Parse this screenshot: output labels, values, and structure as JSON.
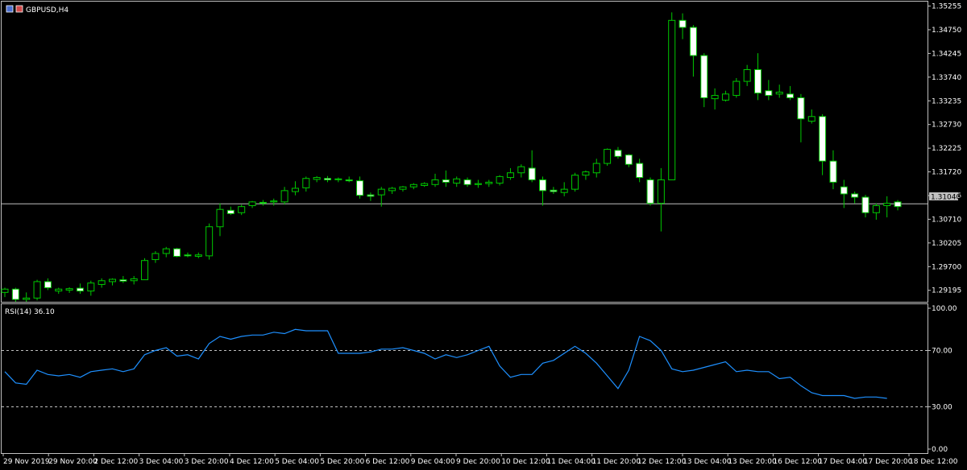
{
  "header": {
    "symbol": "GBPUSD,H4",
    "rsi_label": "RSI(14) 36.10",
    "current_price_tag": "1.31040"
  },
  "colors": {
    "background": "#000000",
    "bull_body": "#000000",
    "bear_body": "#ffffff",
    "wick": "#00c800",
    "rsi_line": "#1e90ff",
    "grid_dashed": "#c0c0c0",
    "price_line": "#c0c0c0",
    "frame": "#c0c0c0"
  },
  "chart_data": [
    {
      "type": "candlestick",
      "title": "GBPUSD,H4",
      "ylim": [
        1.2895,
        1.3535
      ],
      "price_ticks": [
        "1.35255",
        "1.34750",
        "1.34245",
        "1.33740",
        "1.33235",
        "1.32730",
        "1.32225",
        "1.31720",
        "1.31215",
        "1.30710",
        "1.30205",
        "1.29700",
        "1.29195"
      ],
      "current_price": 1.3104,
      "x_labels": [
        "29 Nov 2019",
        "29 Nov 20:00",
        "2 Dec 12:00",
        "3 Dec 04:00",
        "3 Dec 20:00",
        "4 Dec 12:00",
        "5 Dec 04:00",
        "5 Dec 20:00",
        "6 Dec 12:00",
        "9 Dec 04:00",
        "9 Dec 20:00",
        "10 Dec 12:00",
        "11 Dec 04:00",
        "11 Dec 20:00",
        "12 Dec 12:00",
        "13 Dec 04:00",
        "13 Dec 20:00",
        "16 Dec 12:00",
        "17 Dec 04:00",
        "17 Dec 20:00",
        "18 Dec 12:00"
      ],
      "candles": [
        {
          "o": 1.2915,
          "h": 1.2925,
          "l": 1.2905,
          "c": 1.2922
        },
        {
          "o": 1.2922,
          "h": 1.2925,
          "l": 1.2895,
          "c": 1.29
        },
        {
          "o": 1.29,
          "h": 1.2915,
          "l": 1.2895,
          "c": 1.2903
        },
        {
          "o": 1.2903,
          "h": 1.2942,
          "l": 1.2898,
          "c": 1.2938
        },
        {
          "o": 1.2938,
          "h": 1.2945,
          "l": 1.292,
          "c": 1.2925
        },
        {
          "o": 1.2918,
          "h": 1.2925,
          "l": 1.2912,
          "c": 1.2922
        },
        {
          "o": 1.292,
          "h": 1.2926,
          "l": 1.2914,
          "c": 1.2923
        },
        {
          "o": 1.2924,
          "h": 1.2934,
          "l": 1.2912,
          "c": 1.2918
        },
        {
          "o": 1.2918,
          "h": 1.294,
          "l": 1.2908,
          "c": 1.2935
        },
        {
          "o": 1.2932,
          "h": 1.2945,
          "l": 1.2925,
          "c": 1.294
        },
        {
          "o": 1.2938,
          "h": 1.2945,
          "l": 1.293,
          "c": 1.2943
        },
        {
          "o": 1.2942,
          "h": 1.295,
          "l": 1.2935,
          "c": 1.2939
        },
        {
          "o": 1.294,
          "h": 1.295,
          "l": 1.2932,
          "c": 1.2944
        },
        {
          "o": 1.2942,
          "h": 1.2988,
          "l": 1.2942,
          "c": 1.2983
        },
        {
          "o": 1.2985,
          "h": 1.3003,
          "l": 1.2978,
          "c": 1.2998
        },
        {
          "o": 1.2998,
          "h": 1.3012,
          "l": 1.299,
          "c": 1.3008
        },
        {
          "o": 1.3008,
          "h": 1.301,
          "l": 1.299,
          "c": 1.2992
        },
        {
          "o": 1.2995,
          "h": 1.3,
          "l": 1.299,
          "c": 1.2993
        },
        {
          "o": 1.2992,
          "h": 1.3,
          "l": 1.2988,
          "c": 1.2995
        },
        {
          "o": 1.2993,
          "h": 1.3062,
          "l": 1.2985,
          "c": 1.3055
        },
        {
          "o": 1.3055,
          "h": 1.3105,
          "l": 1.3035,
          "c": 1.3092
        },
        {
          "o": 1.309,
          "h": 1.3098,
          "l": 1.308,
          "c": 1.3083
        },
        {
          "o": 1.3085,
          "h": 1.3102,
          "l": 1.308,
          "c": 1.3098
        },
        {
          "o": 1.31,
          "h": 1.311,
          "l": 1.3095,
          "c": 1.3108
        },
        {
          "o": 1.3107,
          "h": 1.3112,
          "l": 1.31,
          "c": 1.3105
        },
        {
          "o": 1.3108,
          "h": 1.3115,
          "l": 1.31,
          "c": 1.311
        },
        {
          "o": 1.3108,
          "h": 1.314,
          "l": 1.3102,
          "c": 1.3132
        },
        {
          "o": 1.313,
          "h": 1.3152,
          "l": 1.3122,
          "c": 1.3137
        },
        {
          "o": 1.3138,
          "h": 1.3162,
          "l": 1.313,
          "c": 1.3158
        },
        {
          "o": 1.3156,
          "h": 1.3163,
          "l": 1.315,
          "c": 1.316
        },
        {
          "o": 1.3158,
          "h": 1.3163,
          "l": 1.315,
          "c": 1.3155
        },
        {
          "o": 1.3156,
          "h": 1.316,
          "l": 1.315,
          "c": 1.3157
        },
        {
          "o": 1.3155,
          "h": 1.3162,
          "l": 1.315,
          "c": 1.3153
        },
        {
          "o": 1.3153,
          "h": 1.3162,
          "l": 1.3115,
          "c": 1.3122
        },
        {
          "o": 1.3123,
          "h": 1.3128,
          "l": 1.311,
          "c": 1.312
        },
        {
          "o": 1.3123,
          "h": 1.314,
          "l": 1.3098,
          "c": 1.3135
        },
        {
          "o": 1.3132,
          "h": 1.314,
          "l": 1.3125,
          "c": 1.3137
        },
        {
          "o": 1.3135,
          "h": 1.3142,
          "l": 1.313,
          "c": 1.314
        },
        {
          "o": 1.314,
          "h": 1.3148,
          "l": 1.3135,
          "c": 1.3145
        },
        {
          "o": 1.3143,
          "h": 1.315,
          "l": 1.314,
          "c": 1.3147
        },
        {
          "o": 1.3145,
          "h": 1.3168,
          "l": 1.314,
          "c": 1.3155
        },
        {
          "o": 1.3155,
          "h": 1.3175,
          "l": 1.314,
          "c": 1.315
        },
        {
          "o": 1.3148,
          "h": 1.3162,
          "l": 1.314,
          "c": 1.3157
        },
        {
          "o": 1.3155,
          "h": 1.316,
          "l": 1.314,
          "c": 1.3145
        },
        {
          "o": 1.3145,
          "h": 1.3155,
          "l": 1.3138,
          "c": 1.3147
        },
        {
          "o": 1.3147,
          "h": 1.3155,
          "l": 1.314,
          "c": 1.315
        },
        {
          "o": 1.3148,
          "h": 1.3165,
          "l": 1.3143,
          "c": 1.3162
        },
        {
          "o": 1.316,
          "h": 1.318,
          "l": 1.3155,
          "c": 1.317
        },
        {
          "o": 1.317,
          "h": 1.3188,
          "l": 1.316,
          "c": 1.3183
        },
        {
          "o": 1.318,
          "h": 1.3218,
          "l": 1.315,
          "c": 1.3155
        },
        {
          "o": 1.3155,
          "h": 1.3162,
          "l": 1.31,
          "c": 1.3132
        },
        {
          "o": 1.3133,
          "h": 1.314,
          "l": 1.3125,
          "c": 1.313
        },
        {
          "o": 1.3128,
          "h": 1.315,
          "l": 1.312,
          "c": 1.3135
        },
        {
          "o": 1.3135,
          "h": 1.317,
          "l": 1.313,
          "c": 1.3165
        },
        {
          "o": 1.3165,
          "h": 1.3175,
          "l": 1.3155,
          "c": 1.3172
        },
        {
          "o": 1.317,
          "h": 1.32,
          "l": 1.316,
          "c": 1.319
        },
        {
          "o": 1.319,
          "h": 1.3222,
          "l": 1.3185,
          "c": 1.322
        },
        {
          "o": 1.3218,
          "h": 1.3225,
          "l": 1.32,
          "c": 1.3205
        },
        {
          "o": 1.3208,
          "h": 1.321,
          "l": 1.3182,
          "c": 1.3188
        },
        {
          "o": 1.319,
          "h": 1.32,
          "l": 1.315,
          "c": 1.316
        },
        {
          "o": 1.3155,
          "h": 1.316,
          "l": 1.31,
          "c": 1.3105
        },
        {
          "o": 1.3105,
          "h": 1.318,
          "l": 1.3045,
          "c": 1.3155
        },
        {
          "o": 1.3155,
          "h": 1.3512,
          "l": 1.3155,
          "c": 1.3495
        },
        {
          "o": 1.3495,
          "h": 1.351,
          "l": 1.3455,
          "c": 1.348
        },
        {
          "o": 1.348,
          "h": 1.3485,
          "l": 1.3375,
          "c": 1.342
        },
        {
          "o": 1.342,
          "h": 1.3425,
          "l": 1.331,
          "c": 1.333
        },
        {
          "o": 1.3328,
          "h": 1.335,
          "l": 1.3305,
          "c": 1.3335
        },
        {
          "o": 1.3325,
          "h": 1.3345,
          "l": 1.3322,
          "c": 1.3338
        },
        {
          "o": 1.3335,
          "h": 1.3372,
          "l": 1.333,
          "c": 1.3365
        },
        {
          "o": 1.3365,
          "h": 1.34,
          "l": 1.3355,
          "c": 1.339
        },
        {
          "o": 1.339,
          "h": 1.3425,
          "l": 1.3325,
          "c": 1.334
        },
        {
          "o": 1.3345,
          "h": 1.3368,
          "l": 1.3325,
          "c": 1.3335
        },
        {
          "o": 1.3338,
          "h": 1.3358,
          "l": 1.333,
          "c": 1.3342
        },
        {
          "o": 1.3338,
          "h": 1.3355,
          "l": 1.3325,
          "c": 1.333
        },
        {
          "o": 1.333,
          "h": 1.3338,
          "l": 1.3235,
          "c": 1.3285
        },
        {
          "o": 1.328,
          "h": 1.3305,
          "l": 1.3275,
          "c": 1.329
        },
        {
          "o": 1.329,
          "h": 1.3295,
          "l": 1.3165,
          "c": 1.3195
        },
        {
          "o": 1.3195,
          "h": 1.3218,
          "l": 1.3135,
          "c": 1.315
        },
        {
          "o": 1.314,
          "h": 1.3155,
          "l": 1.3095,
          "c": 1.3125
        },
        {
          "o": 1.3125,
          "h": 1.313,
          "l": 1.3105,
          "c": 1.3118
        },
        {
          "o": 1.3118,
          "h": 1.3123,
          "l": 1.3075,
          "c": 1.3085
        },
        {
          "o": 1.3085,
          "h": 1.3105,
          "l": 1.307,
          "c": 1.31
        },
        {
          "o": 1.31,
          "h": 1.312,
          "l": 1.3075,
          "c": 1.3105
        },
        {
          "o": 1.3108,
          "h": 1.3112,
          "l": 1.309,
          "c": 1.3098
        }
      ]
    },
    {
      "type": "line",
      "title": "RSI(14) 36.10",
      "ylim": [
        0,
        100
      ],
      "y_ticks": [
        "100.00",
        "70.00",
        "30.00",
        "0.00"
      ],
      "levels": [
        70,
        30
      ],
      "series": [
        {
          "values": [
            55,
            47,
            46,
            56,
            53,
            52,
            53,
            51,
            55,
            56,
            57,
            55,
            57,
            67,
            70,
            72,
            66,
            67,
            64,
            75,
            80,
            78,
            80,
            81,
            81,
            83,
            82,
            85,
            84,
            84,
            84,
            68,
            68,
            68,
            69,
            71,
            71,
            72,
            70,
            68,
            64,
            67,
            65,
            67,
            70,
            73,
            59,
            51,
            53,
            53,
            61,
            63,
            68,
            73,
            68,
            61,
            52,
            43,
            56,
            80,
            77,
            70,
            57,
            55,
            56,
            58,
            60,
            62,
            55,
            56,
            55,
            55,
            50,
            51,
            45,
            40,
            38,
            38,
            38,
            36,
            37,
            37,
            36
          ]
        }
      ]
    }
  ]
}
